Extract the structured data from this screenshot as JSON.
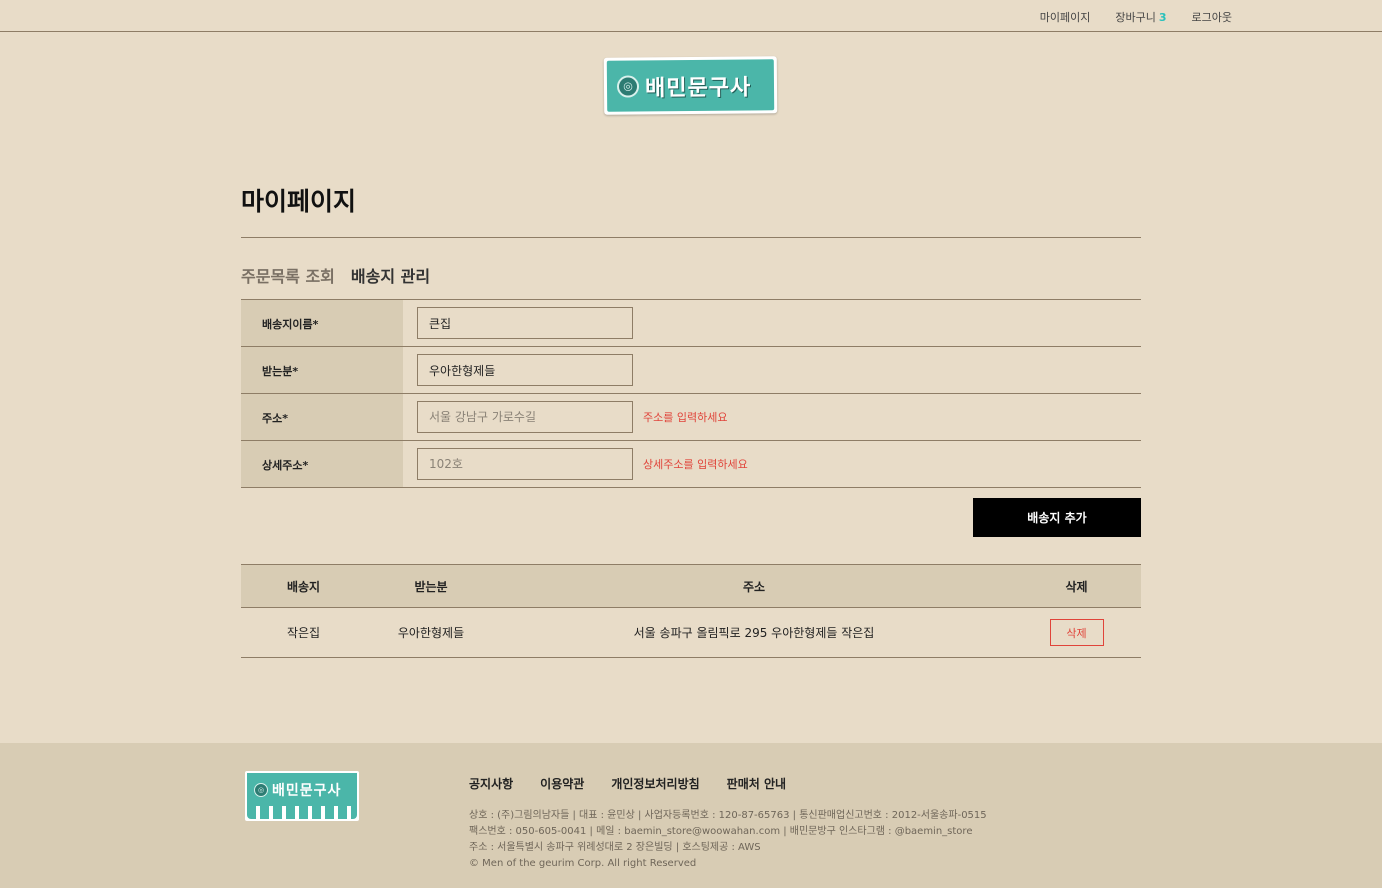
{
  "topnav": {
    "mypage": "마이페이지",
    "cart": "장바구니",
    "cart_count": "3",
    "logout": "로그아웃"
  },
  "logo": {
    "text": "배민문구사"
  },
  "page": {
    "title": "마이페이지"
  },
  "tabs": [
    {
      "label": "주문목록 조회",
      "active": false
    },
    {
      "label": "배송지 관리",
      "active": true
    }
  ],
  "form": {
    "rows": [
      {
        "label": "배송지이름*",
        "value": "큰집",
        "placeholder": "",
        "error": ""
      },
      {
        "label": "받는분*",
        "value": "우아한형제들",
        "placeholder": "",
        "error": ""
      },
      {
        "label": "주소*",
        "value": "",
        "placeholder": "서울 강남구 가로수길",
        "error": "주소를 입력하세요"
      },
      {
        "label": "상세주소*",
        "value": "",
        "placeholder": "102호",
        "error": "상세주소를 입력하세요"
      }
    ],
    "submit_label": "배송지 추가"
  },
  "list": {
    "headers": [
      "배송지",
      "받는분",
      "주소",
      "삭제"
    ],
    "rows": [
      {
        "name": "작은집",
        "recipient": "우아한형제들",
        "address": "서울 송파구 올림픽로 295 우아한형제들 작은집",
        "delete_label": "삭제"
      }
    ]
  },
  "footer": {
    "logo_text": "배민문구사",
    "links": [
      "공지사항",
      "이용약관",
      "개인정보처리방침",
      "판매처 안내"
    ],
    "info": [
      "상호 : (주)그림의남자들 | 대표 : 윤민상 | 사업자등록번호 : 120-87-65763 | 통신판매업신고번호 : 2012-서울송파-0515",
      "팩스번호 : 050-605-0041 | 메일 : baemin_store@woowahan.com | 배민문방구 인스타그램 : @baemin_store",
      "주소 : 서울특별시 송파구 위례성대로 2 장은빌딩 | 호스팅제공 : AWS",
      "© Men of the geurim Corp. All right Reserved"
    ]
  },
  "colors": {
    "background": "#e8dcc8",
    "panel": "#d8ccb4",
    "accent": "#2bc1bc",
    "logo": "#4bb6a9",
    "error": "#e0443a"
  }
}
